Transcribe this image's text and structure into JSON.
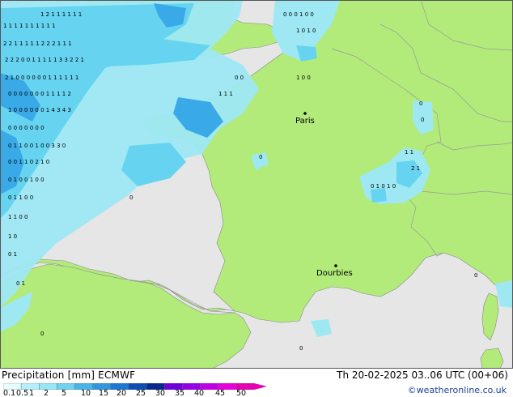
{
  "map": {
    "cities": [
      {
        "name": "Paris"
      },
      {
        "name": "Dourbies"
      }
    ],
    "colors": {
      "sea": "#e6e6e6",
      "land": "#b2eb7a",
      "rain_light": "#9ee8f4",
      "rain_mid": "#66d4f0",
      "rain_heavy": "#3aa9e8",
      "border": "#999999"
    }
  },
  "footer": {
    "title": "Precipitation [mm]  ECMWF",
    "datetime": "Th 20-02-2025 03..06 UTC (00+06)",
    "credit": "©weatheronline.co.uk",
    "scale_ticks": [
      "0.1",
      "0.5",
      "1",
      "2",
      "5",
      "10",
      "15",
      "20",
      "25",
      "30",
      "35",
      "40",
      "45",
      "50"
    ],
    "scale_colors": [
      "#e6ffff",
      "#b4f0fa",
      "#96e6f5",
      "#6ed2f0",
      "#46b4e6",
      "#3296dc",
      "#1e78d2",
      "#0a50b4",
      "#0a288c",
      "#6e00dc",
      "#9600e6",
      "#be00e6",
      "#e600dc",
      "#e600b4"
    ]
  }
}
